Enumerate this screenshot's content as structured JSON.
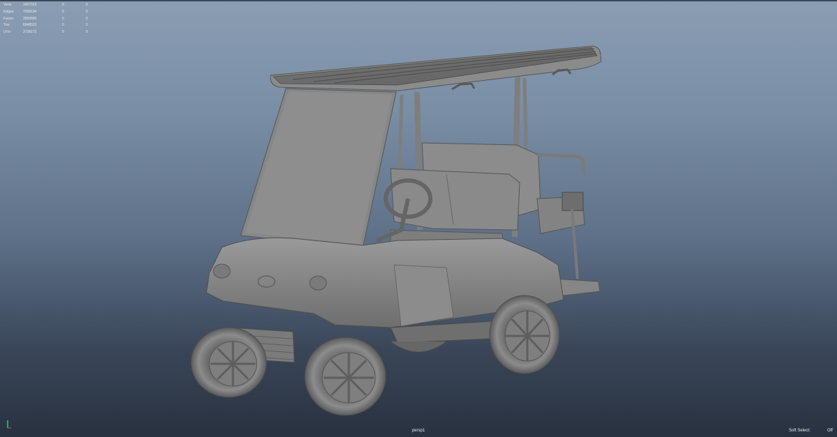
{
  "hud": {
    "rows": [
      {
        "label": "Verts:",
        "total": "3467319",
        "selected": "0",
        "components": "0"
      },
      {
        "label": "Edges:",
        "total": "7008194",
        "selected": "0",
        "components": "0"
      },
      {
        "label": "Faces:",
        "total": "3550690",
        "selected": "0",
        "components": "0"
      },
      {
        "label": "Tris:",
        "total": "6948032",
        "selected": "0",
        "components": "0"
      },
      {
        "label": "UVs:",
        "total": "3738172",
        "selected": "0",
        "components": "0"
      }
    ]
  },
  "viewport": {
    "camera": "persp1",
    "soft_select_label": "Soft Select:",
    "soft_select_value": "Off"
  },
  "colors": {
    "gradient_top": "#8a9db3",
    "gradient_bottom": "#283140",
    "model_gray": "#8e8e8e",
    "axis_y": "#2ecc71"
  }
}
